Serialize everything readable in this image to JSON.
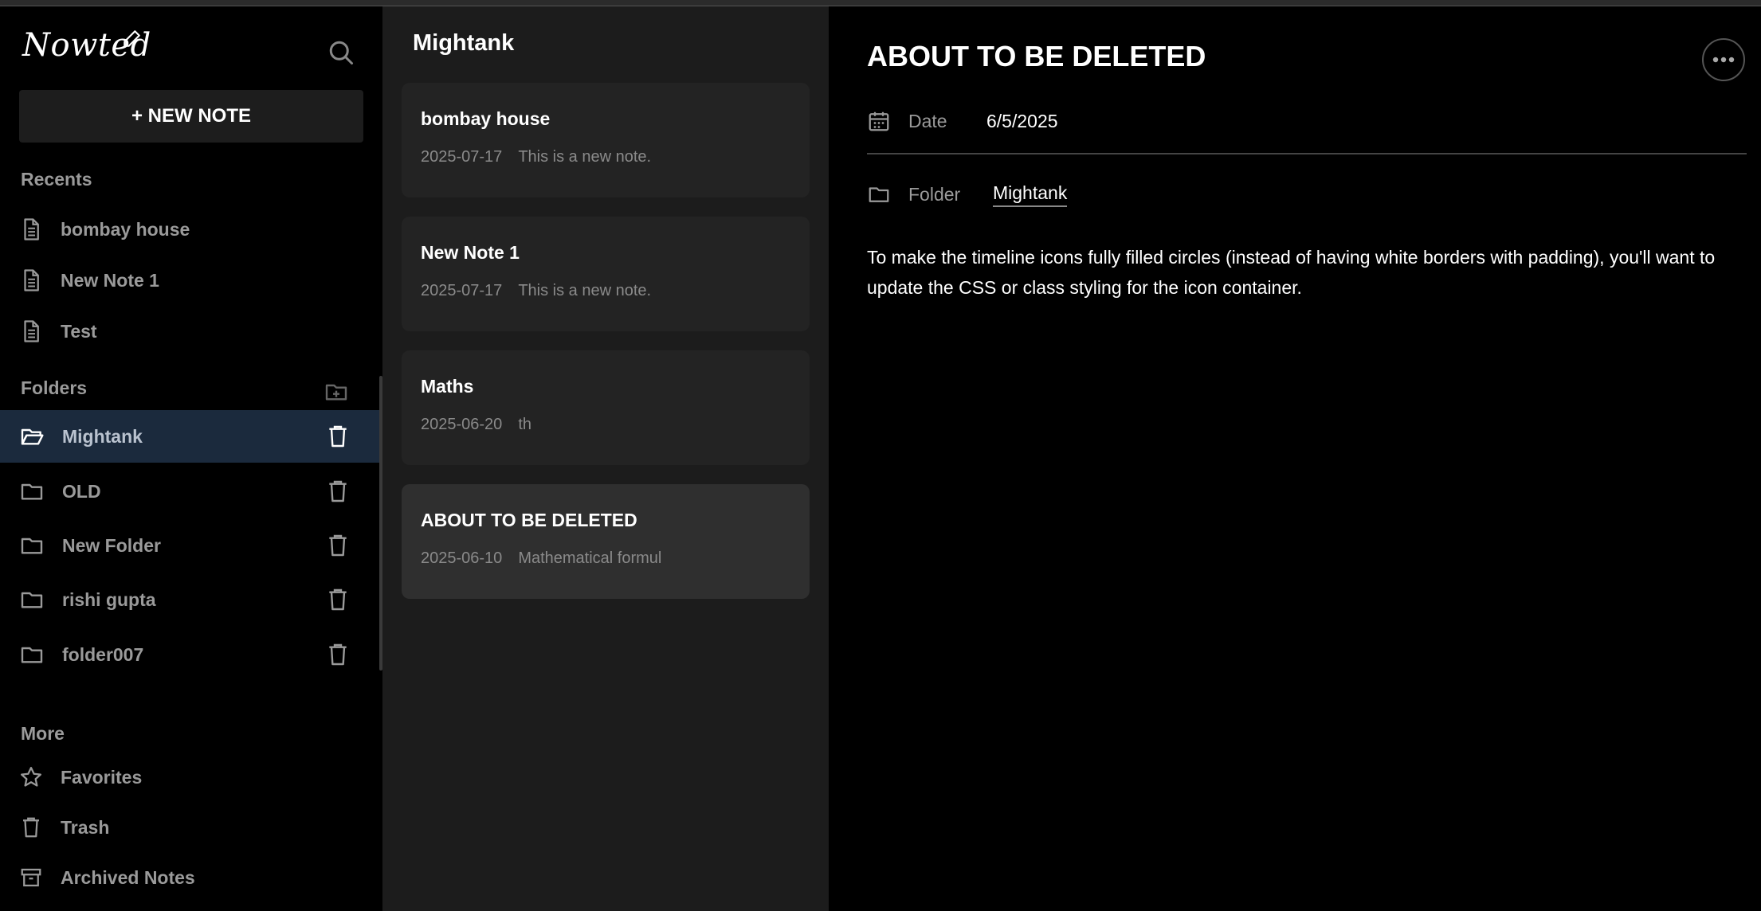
{
  "app": {
    "logo": "Nowted"
  },
  "sidebar": {
    "new_note_label": "+ NEW NOTE",
    "recents_title": "Recents",
    "recents": [
      {
        "label": "bombay house"
      },
      {
        "label": "New Note 1"
      },
      {
        "label": "Test"
      }
    ],
    "folders_title": "Folders",
    "folders": [
      {
        "label": "Mightank",
        "active": true
      },
      {
        "label": "OLD"
      },
      {
        "label": "New Folder"
      },
      {
        "label": "rishi gupta"
      },
      {
        "label": "folder007"
      }
    ],
    "more_title": "More",
    "more": [
      {
        "label": "Favorites",
        "icon": "star-icon"
      },
      {
        "label": "Trash",
        "icon": "trash-icon"
      },
      {
        "label": "Archived Notes",
        "icon": "archive-icon"
      }
    ]
  },
  "notelist": {
    "title": "Mightank",
    "notes": [
      {
        "title": "bombay house",
        "date": "2025-07-17",
        "excerpt": "This is a new note."
      },
      {
        "title": "New Note 1",
        "date": "2025-07-17",
        "excerpt": "This is a new note."
      },
      {
        "title": "Maths",
        "date": "2025-06-20",
        "excerpt": "th"
      },
      {
        "title": "ABOUT TO BE DELETED",
        "date": "2025-06-10",
        "excerpt": "Mathematical formul",
        "active": true
      }
    ]
  },
  "editor": {
    "title": "ABOUT TO BE DELETED",
    "date_label": "Date",
    "date_value": "6/5/2025",
    "folder_label": "Folder",
    "folder_value": "Mightank",
    "body": "To make the timeline icons fully filled circles (instead of having white borders with padding), you'll want to update the CSS or class styling for the icon container."
  },
  "colors": {
    "background": "#000000",
    "notelist_bg": "#1c1c1c",
    "card_bg": "#232323",
    "active_folder": "#1b2a3d",
    "muted_text": "#9a9a9a"
  }
}
